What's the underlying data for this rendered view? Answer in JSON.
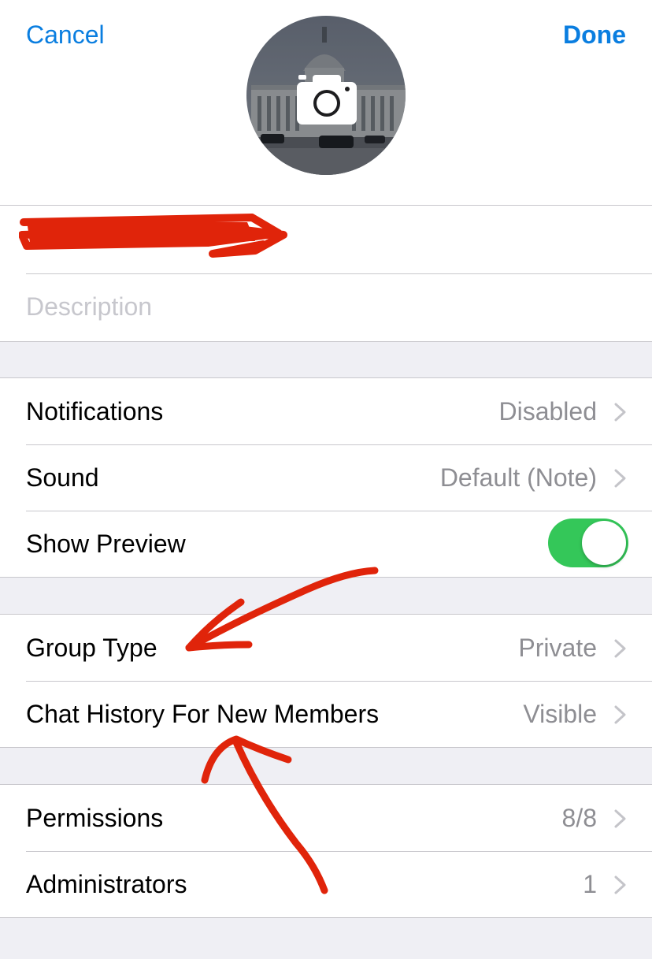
{
  "nav": {
    "cancel_label": "Cancel",
    "done_label": "Done"
  },
  "info": {
    "description_placeholder": "Description"
  },
  "notifications_section": {
    "items": [
      {
        "label": "Notifications",
        "value": "Disabled"
      },
      {
        "label": "Sound",
        "value": "Default (Note)"
      },
      {
        "label": "Show Preview",
        "toggle_on": true
      }
    ]
  },
  "group_section": {
    "items": [
      {
        "label": "Group Type",
        "value": "Private"
      },
      {
        "label": "Chat History For New Members",
        "value": "Visible"
      }
    ]
  },
  "admin_section": {
    "items": [
      {
        "label": "Permissions",
        "value": "8/8"
      },
      {
        "label": "Administrators",
        "value": "1"
      }
    ]
  },
  "colors": {
    "accent": "#0a7ee0",
    "toggle_on": "#34c759",
    "annotation": "#e0240a"
  },
  "icons": {
    "avatar_overlay": "camera-icon",
    "row_disclosure": "chevron-right-icon"
  }
}
